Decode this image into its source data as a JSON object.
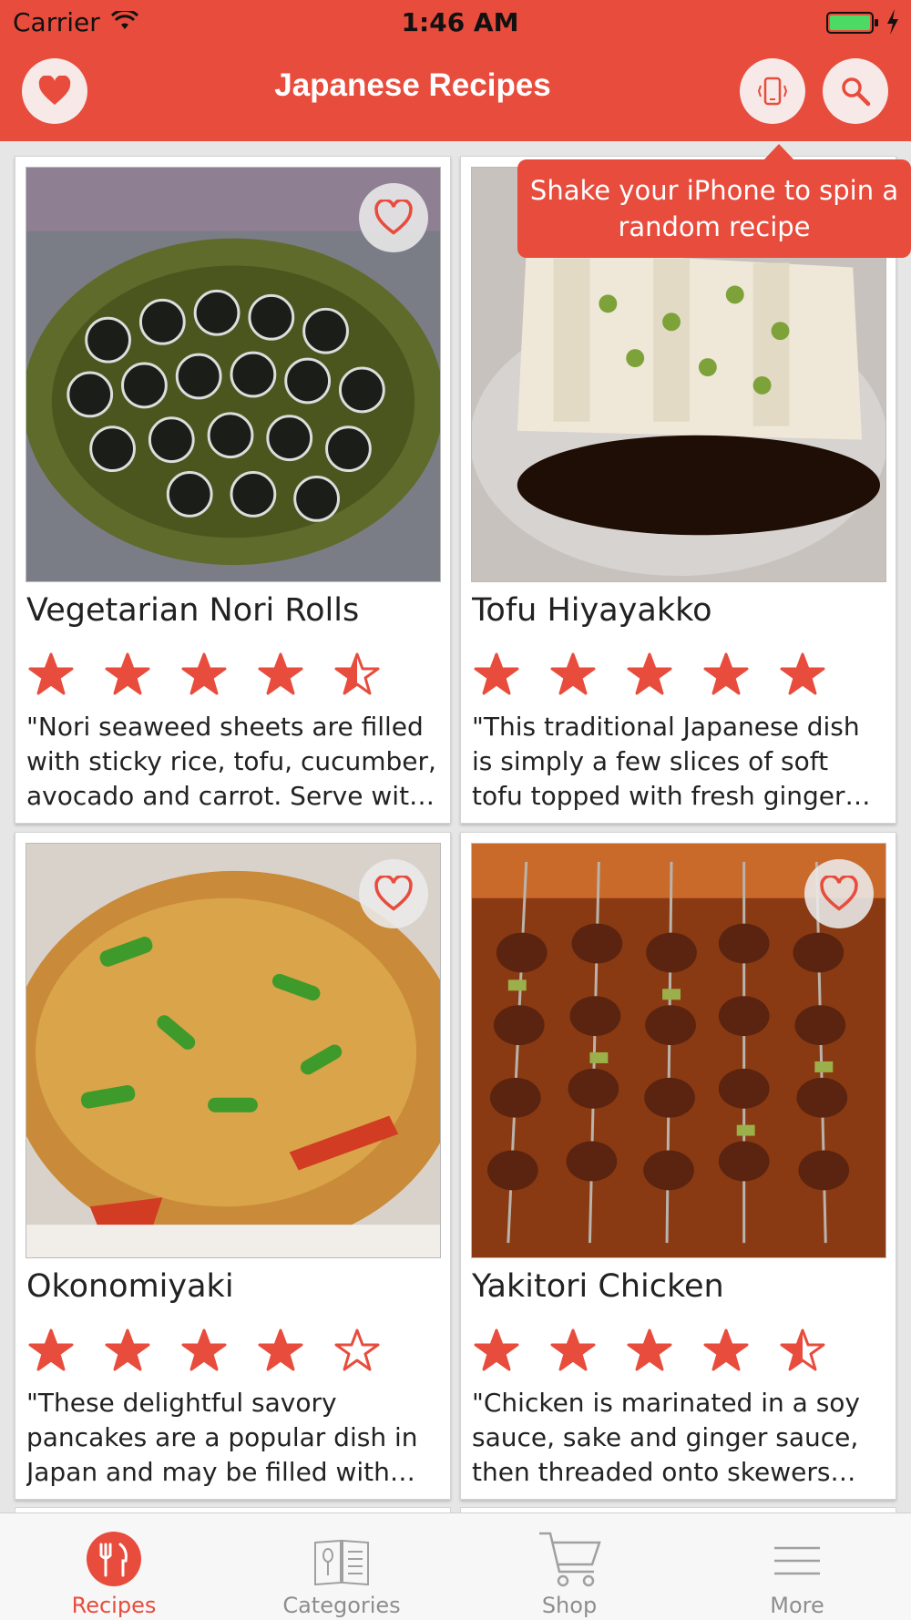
{
  "status": {
    "carrier": "Carrier",
    "time": "1:46 AM"
  },
  "header": {
    "title": "Japanese Recipes",
    "accent_color": "#e84c3d",
    "icons": [
      "heart-icon",
      "shake-phone-icon",
      "search-icon"
    ]
  },
  "tooltip": {
    "text": "Shake your iPhone to spin a random recipe"
  },
  "recipes": [
    {
      "title": "Vegetarian Nori Rolls",
      "rating": 4.5,
      "favorite_visible": true,
      "description": "\"Nori seaweed sheets are filled with sticky rice, tofu, cucumber, avocado and carrot.  Serve with wasabi, pickled ginger and soy sauce.\""
    },
    {
      "title": "Tofu Hiyayakko",
      "rating": 5,
      "favorite_visible": false,
      "description": "\"This traditional Japanese dish is simply a few slices of soft tofu topped with fresh ginger and green onions, with soy sauce.\""
    },
    {
      "title": "Okonomiyaki",
      "rating": 4,
      "favorite_visible": true,
      "description": "\"These delightful savory pancakes are a popular dish in Japan and may be filled with whatever meat and vegetables you like.\""
    },
    {
      "title": "Yakitori Chicken",
      "rating": 4.5,
      "favorite_visible": true,
      "description": "\"Chicken is marinated in a soy sauce, sake and ginger sauce, then threaded onto skewers and broiled until golden.\""
    }
  ],
  "tabs": [
    {
      "label": "Recipes",
      "icon": "fork-knife-icon",
      "active": true
    },
    {
      "label": "Categories",
      "icon": "book-icon",
      "active": false
    },
    {
      "label": "Shop",
      "icon": "cart-icon",
      "active": false
    },
    {
      "label": "More",
      "icon": "menu-icon",
      "active": false
    }
  ]
}
